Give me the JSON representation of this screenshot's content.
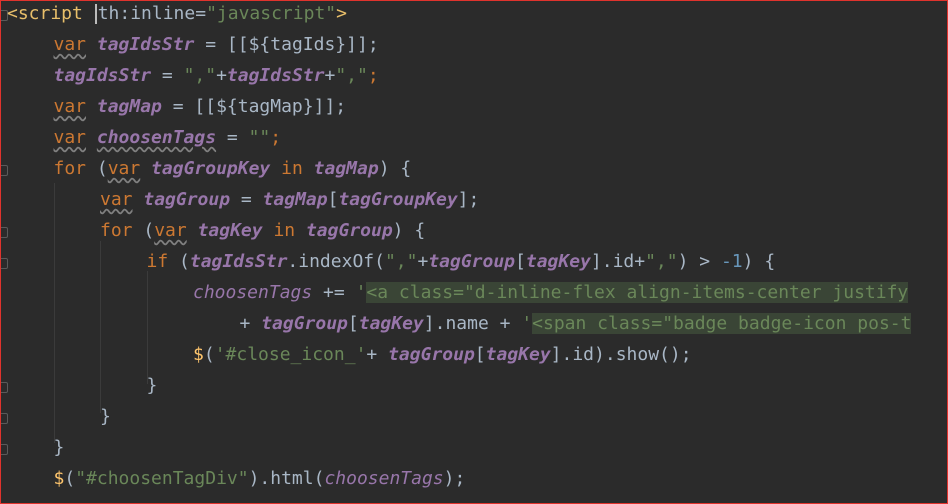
{
  "lines": [
    {
      "indent": 0,
      "tokens": [
        {
          "t": "tag",
          "v": "<script "
        },
        {
          "t": "caret",
          "v": ""
        },
        {
          "t": "p",
          "v": "th:inline="
        },
        {
          "t": "s",
          "v": "\"javascript\""
        },
        {
          "t": "tag",
          "v": ">"
        }
      ]
    },
    {
      "indent": 1,
      "tokens": [
        {
          "t": "kw ul",
          "v": "var"
        },
        {
          "t": "p",
          "v": " "
        },
        {
          "t": "v",
          "v": "tagIdsStr"
        },
        {
          "t": "p",
          "v": " = [["
        },
        {
          "t": "p",
          "v": "${tagIds}"
        },
        {
          "t": "p",
          "v": "]];"
        }
      ]
    },
    {
      "indent": 1,
      "tokens": [
        {
          "t": "v",
          "v": "tagIdsStr"
        },
        {
          "t": "p",
          "v": " = "
        },
        {
          "t": "s",
          "v": "\",\""
        },
        {
          "t": "p",
          "v": "+"
        },
        {
          "t": "v",
          "v": "tagIdsStr"
        },
        {
          "t": "p",
          "v": "+"
        },
        {
          "t": "s",
          "v": "\",\""
        },
        {
          "t": "kw",
          "v": ";"
        }
      ]
    },
    {
      "indent": 1,
      "tokens": [
        {
          "t": "kw ul",
          "v": "var"
        },
        {
          "t": "p",
          "v": " "
        },
        {
          "t": "v",
          "v": "tagMap"
        },
        {
          "t": "p",
          "v": " = [["
        },
        {
          "t": "p",
          "v": "${tagMap}"
        },
        {
          "t": "p",
          "v": "]];"
        }
      ]
    },
    {
      "indent": 1,
      "tokens": [
        {
          "t": "kw ul",
          "v": "var"
        },
        {
          "t": "p",
          "v": " "
        },
        {
          "t": "v ul",
          "v": "choosenTags"
        },
        {
          "t": "p",
          "v": " = "
        },
        {
          "t": "s",
          "v": "\"\""
        },
        {
          "t": "kw",
          "v": ";"
        }
      ]
    },
    {
      "indent": 1,
      "tokens": [
        {
          "t": "kw",
          "v": "for"
        },
        {
          "t": "p",
          "v": " ("
        },
        {
          "t": "kw ul",
          "v": "var"
        },
        {
          "t": "p",
          "v": " "
        },
        {
          "t": "v",
          "v": "tagGroupKey"
        },
        {
          "t": "p",
          "v": " "
        },
        {
          "t": "kw",
          "v": "in"
        },
        {
          "t": "p",
          "v": " "
        },
        {
          "t": "v",
          "v": "tagMap"
        },
        {
          "t": "p",
          "v": ") {"
        }
      ]
    },
    {
      "indent": 2,
      "tokens": [
        {
          "t": "kw ul",
          "v": "var"
        },
        {
          "t": "p",
          "v": " "
        },
        {
          "t": "v",
          "v": "tagGroup"
        },
        {
          "t": "p",
          "v": " = "
        },
        {
          "t": "v",
          "v": "tagMap"
        },
        {
          "t": "p",
          "v": "["
        },
        {
          "t": "v",
          "v": "tagGroupKey"
        },
        {
          "t": "p",
          "v": "];"
        }
      ]
    },
    {
      "indent": 2,
      "tokens": [
        {
          "t": "kw",
          "v": "for"
        },
        {
          "t": "p",
          "v": " ("
        },
        {
          "t": "kw ul",
          "v": "var"
        },
        {
          "t": "p",
          "v": " "
        },
        {
          "t": "v",
          "v": "tagKey"
        },
        {
          "t": "p",
          "v": " "
        },
        {
          "t": "kw",
          "v": "in"
        },
        {
          "t": "p",
          "v": " "
        },
        {
          "t": "v",
          "v": "tagGroup"
        },
        {
          "t": "p",
          "v": ") {"
        }
      ]
    },
    {
      "indent": 3,
      "tokens": [
        {
          "t": "kw",
          "v": "if"
        },
        {
          "t": "p",
          "v": " ("
        },
        {
          "t": "v",
          "v": "tagIdsStr"
        },
        {
          "t": "p",
          "v": ".indexOf("
        },
        {
          "t": "s",
          "v": "\",\""
        },
        {
          "t": "p",
          "v": "+"
        },
        {
          "t": "v",
          "v": "tagGroup"
        },
        {
          "t": "p",
          "v": "["
        },
        {
          "t": "v",
          "v": "tagKey"
        },
        {
          "t": "p",
          "v": "].id+"
        },
        {
          "t": "s",
          "v": "\",\""
        },
        {
          "t": "p",
          "v": ") > "
        },
        {
          "t": "num",
          "v": "-1"
        },
        {
          "t": "p",
          "v": ") {"
        }
      ]
    },
    {
      "indent": 4,
      "tokens": [
        {
          "t": "vi",
          "v": "choosenTags"
        },
        {
          "t": "p",
          "v": " += "
        },
        {
          "t": "s",
          "v": "'"
        },
        {
          "t": "s hl",
          "v": "<a class=\"d-inline-flex align-items-center justify"
        }
      ]
    },
    {
      "indent": 5,
      "tokens": [
        {
          "t": "p",
          "v": "+ "
        },
        {
          "t": "v",
          "v": "tagGroup"
        },
        {
          "t": "p",
          "v": "["
        },
        {
          "t": "v",
          "v": "tagKey"
        },
        {
          "t": "p",
          "v": "].name + "
        },
        {
          "t": "s",
          "v": "'"
        },
        {
          "t": "s hl",
          "v": "<span class=\"badge badge-icon pos-t"
        }
      ]
    },
    {
      "indent": 4,
      "tokens": [
        {
          "t": "fn",
          "v": "$"
        },
        {
          "t": "p",
          "v": "("
        },
        {
          "t": "s",
          "v": "'#close_icon_'"
        },
        {
          "t": "p",
          "v": "+ "
        },
        {
          "t": "v",
          "v": "tagGroup"
        },
        {
          "t": "p",
          "v": "["
        },
        {
          "t": "v",
          "v": "tagKey"
        },
        {
          "t": "p",
          "v": "].id).show();"
        }
      ]
    },
    {
      "indent": 3,
      "tokens": [
        {
          "t": "p",
          "v": "}"
        }
      ]
    },
    {
      "indent": 2,
      "tokens": [
        {
          "t": "p",
          "v": "}"
        }
      ]
    },
    {
      "indent": 1,
      "tokens": [
        {
          "t": "p",
          "v": "}"
        }
      ]
    },
    {
      "indent": 1,
      "tokens": [
        {
          "t": "fn",
          "v": "$"
        },
        {
          "t": "p",
          "v": "("
        },
        {
          "t": "s",
          "v": "\"#choosenTagDiv\""
        },
        {
          "t": "p",
          "v": ").html("
        },
        {
          "t": "vi",
          "v": "choosenTags"
        },
        {
          "t": "p",
          "v": ");"
        }
      ]
    }
  ],
  "fold_markers_at_lines": [
    0,
    5,
    7,
    8,
    12,
    13,
    14
  ]
}
